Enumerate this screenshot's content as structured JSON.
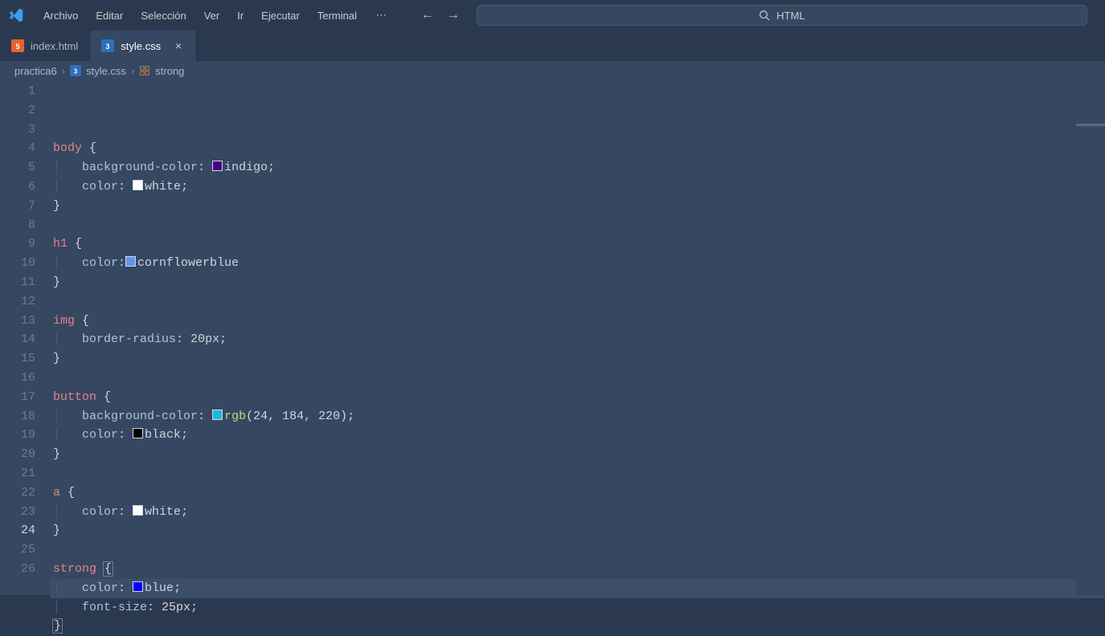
{
  "menu": {
    "items": [
      "Archivo",
      "Editar",
      "Selección",
      "Ver",
      "Ir",
      "Ejecutar",
      "Terminal"
    ]
  },
  "search": {
    "placeholder": "HTML"
  },
  "tabs": [
    {
      "label": "index.html",
      "icon": "html",
      "active": false
    },
    {
      "label": "style.css",
      "icon": "css",
      "active": true
    }
  ],
  "breadcrumb": {
    "root": "practica6",
    "file": "style.css",
    "symbol": "strong"
  },
  "editor": {
    "current_line": 24,
    "lines": [
      {
        "n": 1,
        "tokens": [
          {
            "t": "body",
            "c": "sel"
          },
          {
            "t": " ",
            "c": ""
          },
          {
            "t": "{",
            "c": "punc"
          }
        ]
      },
      {
        "n": 2,
        "indent": 1,
        "tokens": [
          {
            "t": "background-color",
            "c": "prop"
          },
          {
            "t": ": ",
            "c": "punc"
          },
          {
            "swatch": "#4b0082"
          },
          {
            "t": "indigo",
            "c": "val"
          },
          {
            "t": ";",
            "c": "punc"
          }
        ]
      },
      {
        "n": 3,
        "indent": 1,
        "tokens": [
          {
            "t": "color",
            "c": "prop"
          },
          {
            "t": ": ",
            "c": "punc"
          },
          {
            "swatch": "#ffffff"
          },
          {
            "t": "white",
            "c": "val"
          },
          {
            "t": ";",
            "c": "punc"
          }
        ]
      },
      {
        "n": 4,
        "tokens": [
          {
            "t": "}",
            "c": "punc"
          }
        ]
      },
      {
        "n": 5,
        "tokens": []
      },
      {
        "n": 6,
        "tokens": [
          {
            "t": "h1",
            "c": "sel"
          },
          {
            "t": " ",
            "c": ""
          },
          {
            "t": "{",
            "c": "punc"
          }
        ]
      },
      {
        "n": 7,
        "indent": 1,
        "tokens": [
          {
            "t": "color",
            "c": "prop"
          },
          {
            "t": ":",
            "c": "punc"
          },
          {
            "swatch": "#6495ed"
          },
          {
            "t": "cornflowerblue",
            "c": "val"
          }
        ]
      },
      {
        "n": 8,
        "tokens": [
          {
            "t": "}",
            "c": "punc"
          }
        ]
      },
      {
        "n": 9,
        "tokens": []
      },
      {
        "n": 10,
        "tokens": [
          {
            "t": "img",
            "c": "sel"
          },
          {
            "t": " ",
            "c": ""
          },
          {
            "t": "{",
            "c": "punc"
          }
        ]
      },
      {
        "n": 11,
        "indent": 1,
        "tokens": [
          {
            "t": "border-radius",
            "c": "prop"
          },
          {
            "t": ": ",
            "c": "punc"
          },
          {
            "t": "20px",
            "c": "num"
          },
          {
            "t": ";",
            "c": "punc"
          }
        ]
      },
      {
        "n": 12,
        "tokens": [
          {
            "t": "}",
            "c": "punc"
          }
        ]
      },
      {
        "n": 13,
        "tokens": []
      },
      {
        "n": 14,
        "tokens": [
          {
            "t": "button",
            "c": "sel"
          },
          {
            "t": " ",
            "c": ""
          },
          {
            "t": "{",
            "c": "punc"
          }
        ]
      },
      {
        "n": 15,
        "indent": 1,
        "tokens": [
          {
            "t": "background-color",
            "c": "prop"
          },
          {
            "t": ": ",
            "c": "punc"
          },
          {
            "swatch": "#18b8dc"
          },
          {
            "t": "rgb",
            "c": "func"
          },
          {
            "t": "(",
            "c": "punc"
          },
          {
            "t": "24",
            "c": "num"
          },
          {
            "t": ", ",
            "c": "punc"
          },
          {
            "t": "184",
            "c": "num"
          },
          {
            "t": ", ",
            "c": "punc"
          },
          {
            "t": "220",
            "c": "num"
          },
          {
            "t": ")",
            "c": "punc"
          },
          {
            "t": ";",
            "c": "punc"
          }
        ]
      },
      {
        "n": 16,
        "indent": 1,
        "tokens": [
          {
            "t": "color",
            "c": "prop"
          },
          {
            "t": ": ",
            "c": "punc"
          },
          {
            "swatch": "#000000"
          },
          {
            "t": "black",
            "c": "val"
          },
          {
            "t": ";",
            "c": "punc"
          }
        ]
      },
      {
        "n": 17,
        "tokens": [
          {
            "t": "}",
            "c": "punc"
          }
        ]
      },
      {
        "n": 18,
        "tokens": []
      },
      {
        "n": 19,
        "tokens": [
          {
            "t": "a",
            "c": "sel"
          },
          {
            "t": " ",
            "c": ""
          },
          {
            "t": "{",
            "c": "punc"
          }
        ]
      },
      {
        "n": 20,
        "indent": 1,
        "tokens": [
          {
            "t": "color",
            "c": "prop"
          },
          {
            "t": ": ",
            "c": "punc"
          },
          {
            "swatch": "#ffffff"
          },
          {
            "t": "white",
            "c": "val"
          },
          {
            "t": ";",
            "c": "punc"
          }
        ]
      },
      {
        "n": 21,
        "tokens": [
          {
            "t": "}",
            "c": "punc"
          }
        ]
      },
      {
        "n": 22,
        "tokens": []
      },
      {
        "n": 23,
        "tokens": [
          {
            "t": "strong",
            "c": "sel"
          },
          {
            "t": " ",
            "c": ""
          },
          {
            "t": "{",
            "c": "punc",
            "brace": true
          }
        ]
      },
      {
        "n": 24,
        "indent": 1,
        "hl": true,
        "tokens": [
          {
            "t": "color",
            "c": "prop"
          },
          {
            "t": ": ",
            "c": "punc"
          },
          {
            "swatch": "#0000ff"
          },
          {
            "t": "blue",
            "c": "val"
          },
          {
            "t": ";",
            "c": "punc"
          }
        ]
      },
      {
        "n": 25,
        "indent": 1,
        "tokens": [
          {
            "t": "font-size",
            "c": "prop"
          },
          {
            "t": ": ",
            "c": "punc"
          },
          {
            "t": "25px",
            "c": "num"
          },
          {
            "t": ";",
            "c": "punc"
          }
        ]
      },
      {
        "n": 26,
        "tokens": [
          {
            "t": "}",
            "c": "punc",
            "brace": true
          }
        ]
      }
    ]
  }
}
